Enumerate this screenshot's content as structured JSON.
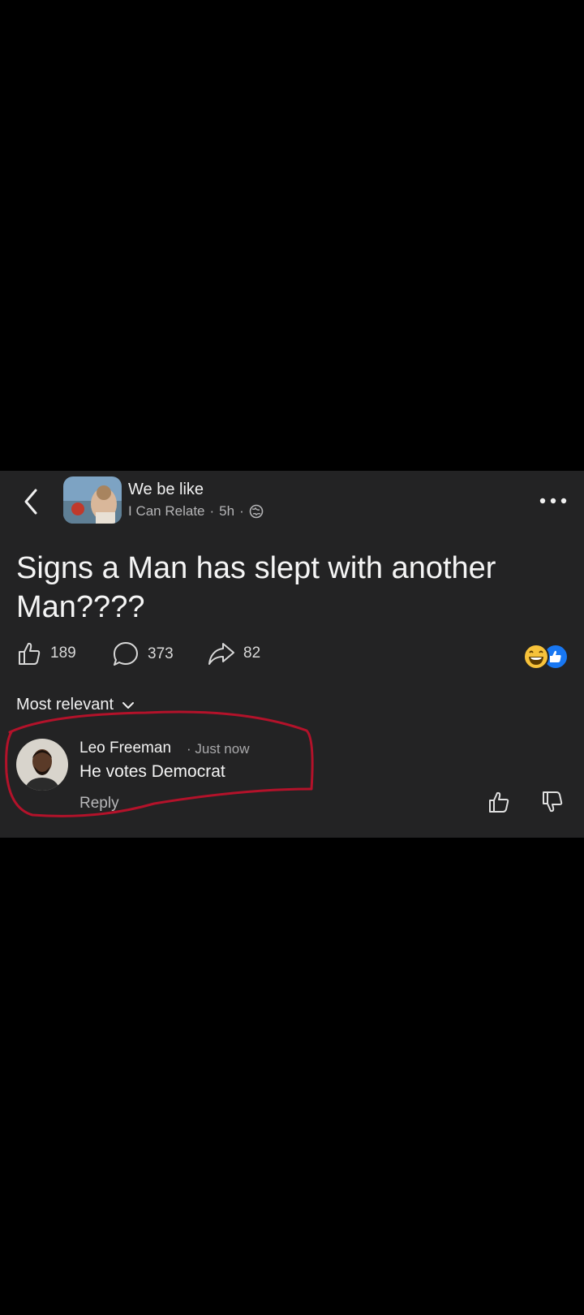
{
  "header": {
    "group_name": "We be like",
    "source_name": "I Can Relate",
    "sep1": "·",
    "time": "5h",
    "sep2": "·",
    "privacy_icon": "globe-icon",
    "back_icon": "chevron-left-icon",
    "more_icon": "more-horizontal-icon"
  },
  "post": {
    "text": "Signs a Man has slept with another Man????"
  },
  "actions": {
    "likes": "189",
    "comments": "373",
    "shares": "82",
    "reactions": [
      "laugh-reaction-icon",
      "like-reaction-icon"
    ]
  },
  "comments_section": {
    "sort_label": "Most relevant",
    "comments": [
      {
        "name": "Leo Freeman",
        "time": "· Just now",
        "text": "He votes Democrat",
        "reply_label": "Reply"
      }
    ]
  },
  "colors": {
    "background": "#000000",
    "panel": "#232324",
    "annotation": "#b3122a",
    "reaction_like": "#1877f2",
    "reaction_laugh": "#f7c23a"
  }
}
